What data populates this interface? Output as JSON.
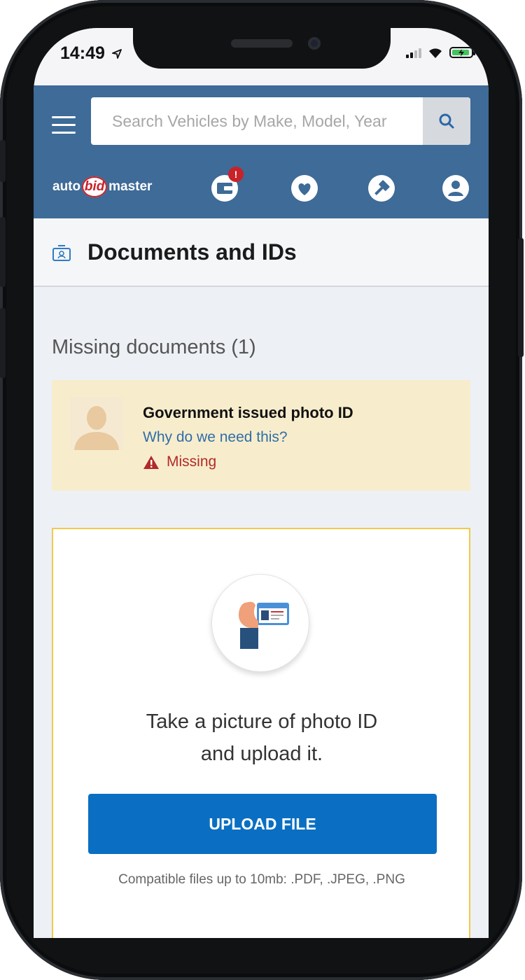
{
  "status_bar": {
    "time": "14:49"
  },
  "header": {
    "search_placeholder": "Search Vehicles by Make, Model, Year",
    "logo": {
      "left": "auto",
      "middle": "bid",
      "right": "master"
    },
    "notification_badge": "!"
  },
  "page": {
    "title": "Documents and IDs"
  },
  "missing_section": {
    "title": "Missing documents (1)"
  },
  "document": {
    "name": "Government issued photo ID",
    "help_link": "Why do we need this?",
    "status": "Missing"
  },
  "upload": {
    "instruction_line1": "Take a picture of photo ID",
    "instruction_line2": "and upload it.",
    "button_label": "UPLOAD FILE",
    "note": "Compatible files up to 10mb: .PDF, .JPEG, .PNG"
  },
  "colors": {
    "header": "#3e6b97",
    "primary_button": "#0a6fc2",
    "missing_card": "#f7edcc",
    "warning": "#b22a2a",
    "upload_border": "#f2c94c"
  }
}
